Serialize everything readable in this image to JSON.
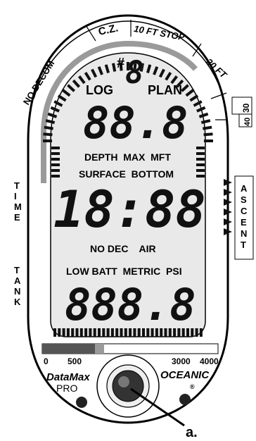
{
  "zones": {
    "cz": "C.Z.",
    "stop10": "10 FT STOP",
    "ft20": "20 FT",
    "n30": "30",
    "n40": "40",
    "nodecom": "NO DECOM"
  },
  "side": {
    "time": [
      "T",
      "I",
      "M",
      "E"
    ],
    "tank": [
      "T",
      "A",
      "N",
      "K"
    ],
    "ascent": [
      "A",
      "S",
      "C",
      "E",
      "N",
      "T"
    ]
  },
  "lcd": {
    "hash": "#",
    "dive_digit": "8",
    "log": "LOG",
    "plan": "PLAN",
    "row1": "88.8",
    "depth_labels": "DEPTH  MAX  MFT",
    "surface_labels": "SURFACE  BOTTOM",
    "time_digits": "18:88",
    "nodec_air": "NO DEC    AIR",
    "batt_labels": "LOW BATT  METRIC  PSI",
    "tank_digits": "888.8"
  },
  "scale": {
    "s0": "0",
    "s500": "500",
    "s3000": "3000",
    "s4000": "4000"
  },
  "brand": {
    "model": "DataMax",
    "sub": "PRO",
    "maker": "OCEANIC",
    "reg": "®"
  },
  "callout": "a."
}
